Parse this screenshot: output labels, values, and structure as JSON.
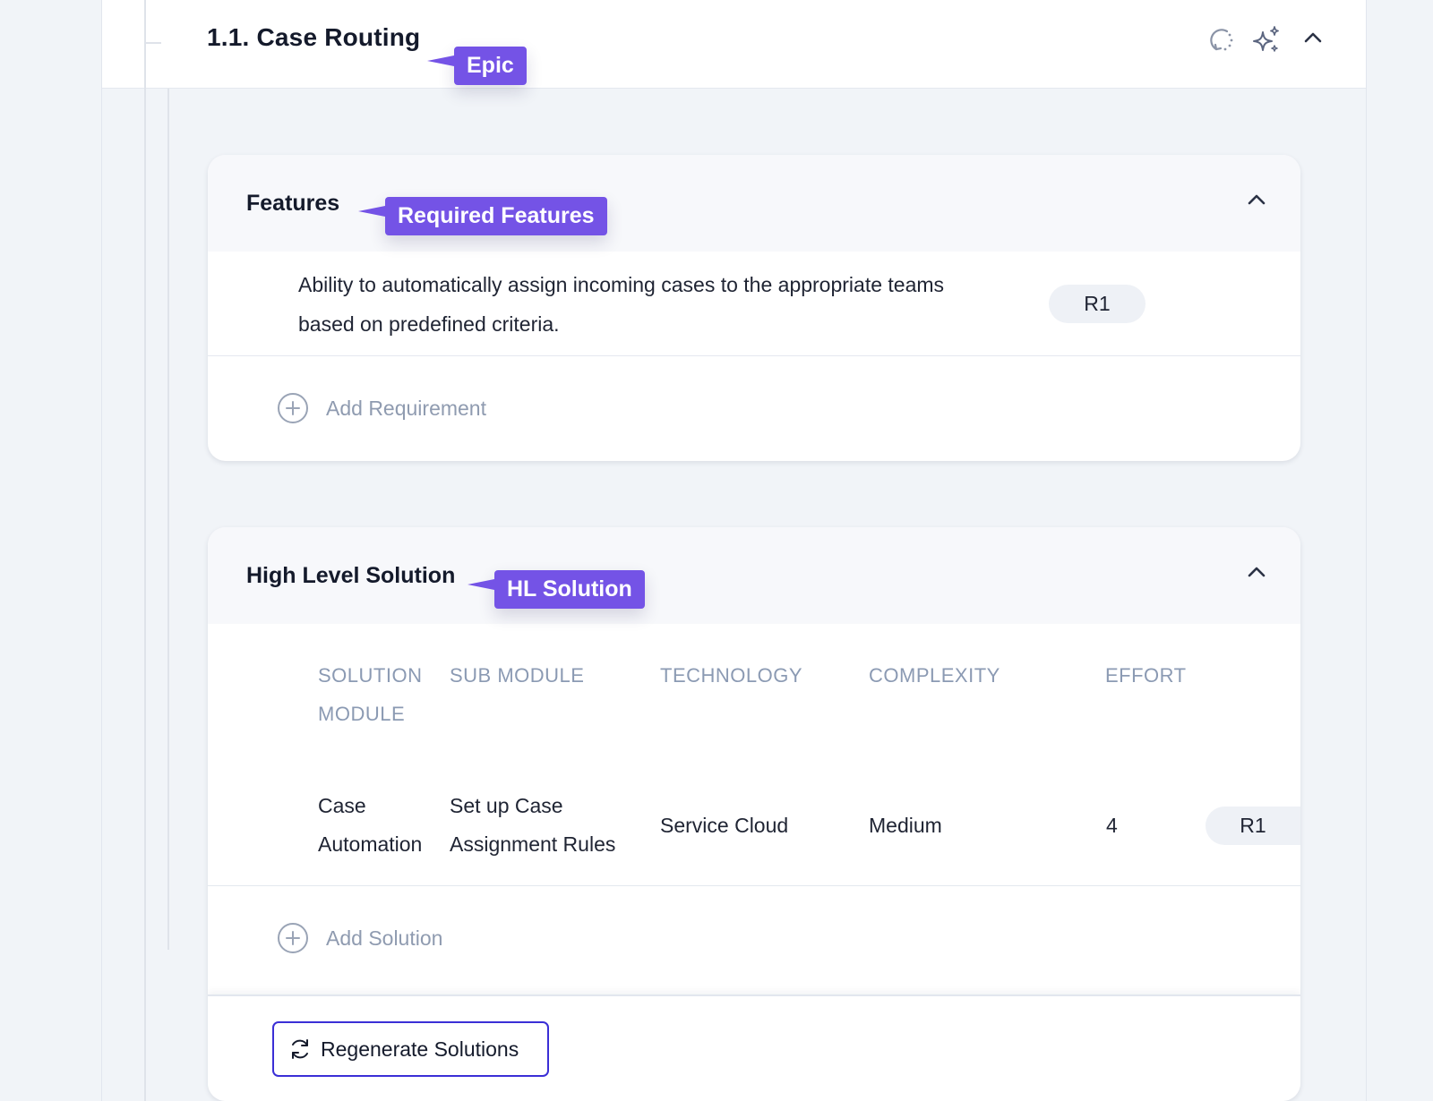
{
  "epic": {
    "title": "1.1. Case Routing",
    "tag": "Epic",
    "icons": [
      "refresh-dotted-icon",
      "sparkle-icon",
      "chevron-up-icon"
    ]
  },
  "features": {
    "title": "Features",
    "tag": "Required Features",
    "requirement": {
      "text": "Ability to automatically assign incoming cases to the appropriate teams based on predefined criteria.",
      "release": "R1"
    },
    "add_label": "Add Requirement"
  },
  "solution": {
    "title": "High Level Solution",
    "tag": "HL Solution",
    "headers": {
      "module_line1": "SOLUTION",
      "module_line2": "MODULE",
      "sub_module": "SUB MODULE",
      "technology": "TECHNOLOGY",
      "complexity": "COMPLEXITY",
      "effort": "EFFORT"
    },
    "row": {
      "module_line1": "Case",
      "module_line2": "Automation",
      "sub_module_line1": "Set up Case",
      "sub_module_line2": "Assignment Rules",
      "technology": "Service Cloud",
      "complexity": "Medium",
      "effort": "4",
      "release": "R1"
    },
    "add_label": "Add Solution",
    "regenerate_label": "Regenerate Solutions"
  },
  "colors": {
    "accent_purple": "#7453e6",
    "button_border": "#3b2fd6",
    "muted_text": "#8f9bb0"
  }
}
